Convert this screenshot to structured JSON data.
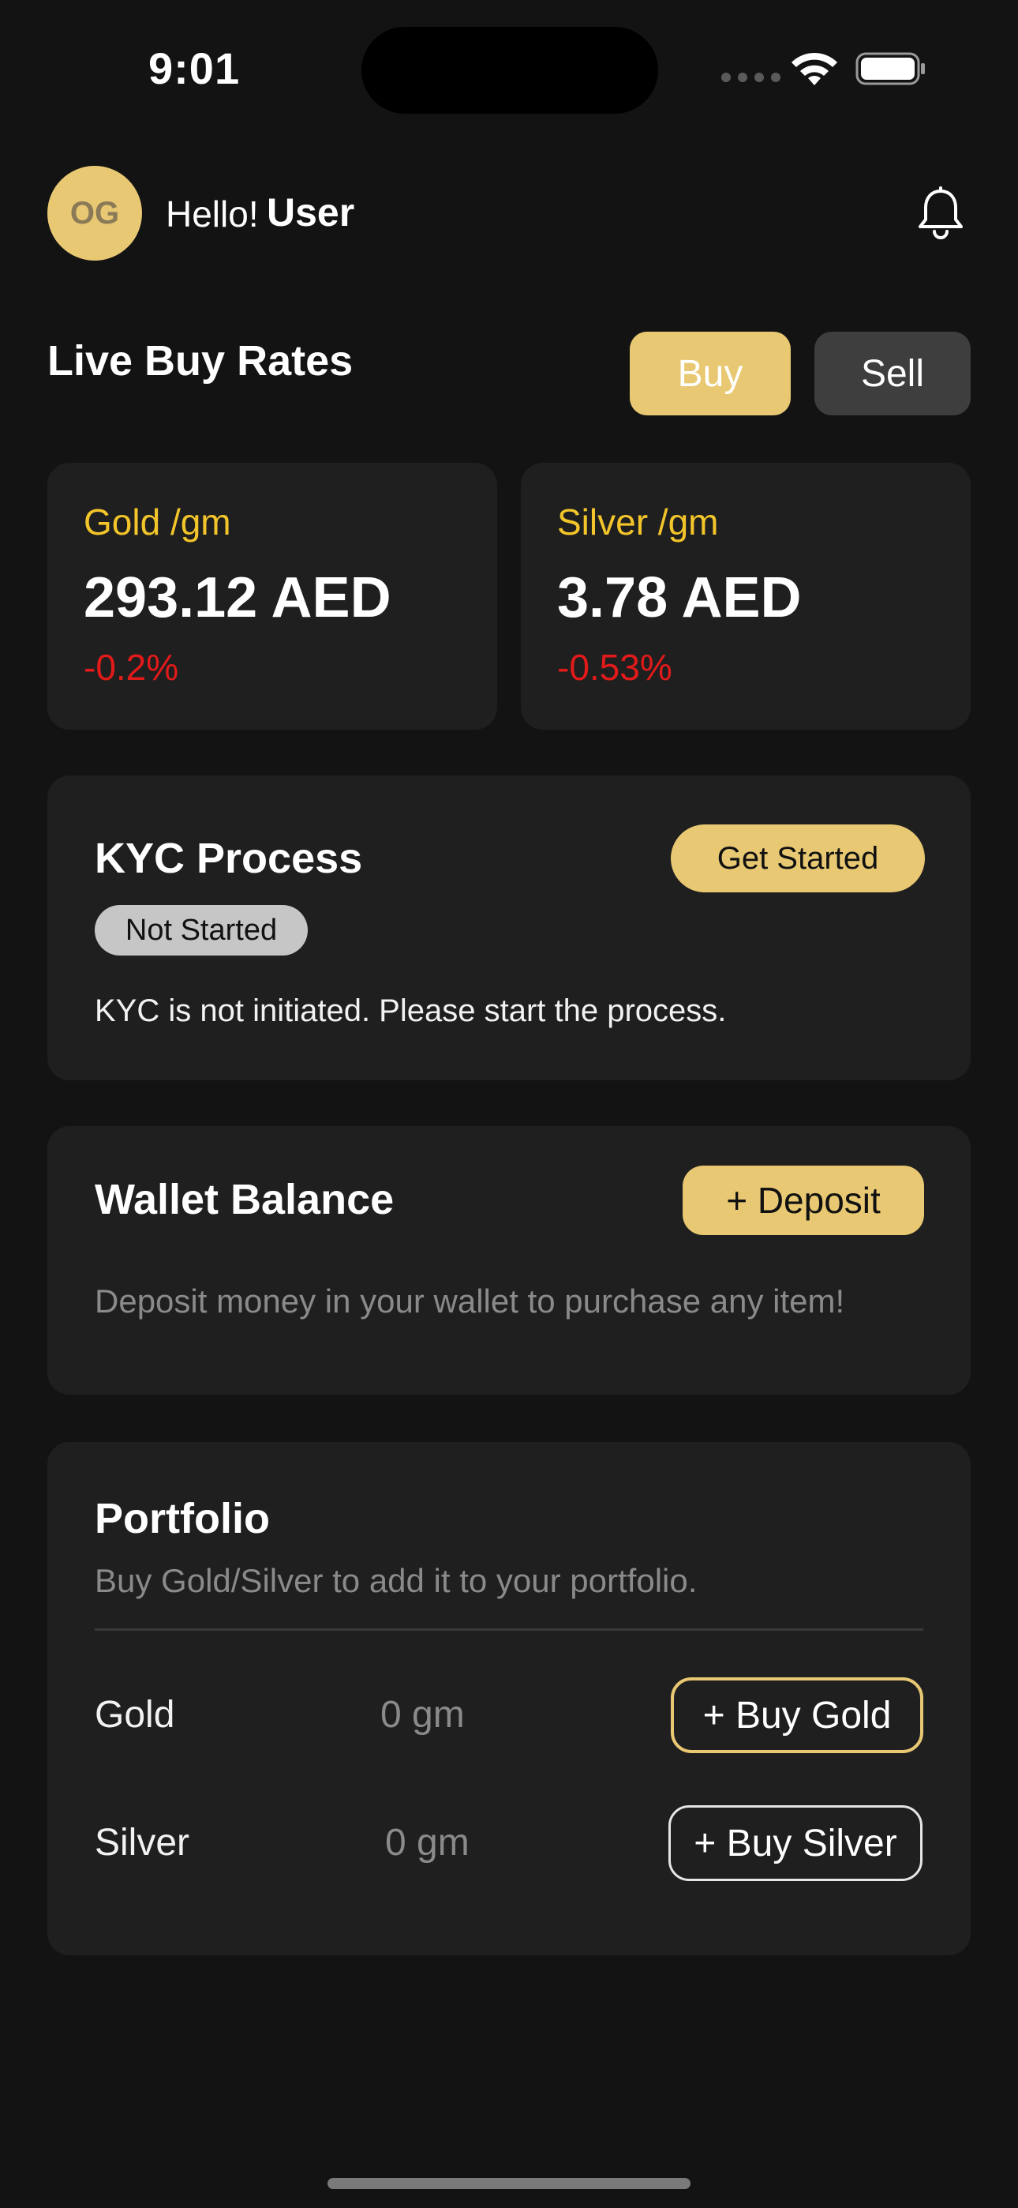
{
  "status_bar": {
    "time": "9:01"
  },
  "header": {
    "avatar_initials": "OG",
    "greeting": "Hello!",
    "username": "User",
    "notification_icon": "bell-icon"
  },
  "rates": {
    "title": "Live Buy Rates",
    "toggle": {
      "buy_label": "Buy",
      "sell_label": "Sell",
      "selected": "Buy"
    },
    "cards": [
      {
        "label": "Gold /gm",
        "value": "293.12 AED",
        "change": "-0.2%"
      },
      {
        "label": "Silver /gm",
        "value": "3.78 AED",
        "change": "-0.53%"
      }
    ]
  },
  "kyc": {
    "title": "KYC Process",
    "button_label": "Get Started",
    "status": "Not Started",
    "message": "KYC is not initiated. Please start the process."
  },
  "wallet": {
    "title": "Wallet Balance",
    "deposit_label": "+ Deposit",
    "message": "Deposit money in your wallet to purchase any item!"
  },
  "portfolio": {
    "title": "Portfolio",
    "subtitle": "Buy Gold/Silver to add it to your portfolio.",
    "rows": [
      {
        "metal": "Gold",
        "quantity": "0 gm",
        "button_label": "+ Buy Gold"
      },
      {
        "metal": "Silver",
        "quantity": "0 gm",
        "button_label": "+ Buy Silver"
      }
    ]
  },
  "colors": {
    "accent": "#e8c872",
    "label_gold": "#f3c52a",
    "negative": "#e21a1a",
    "background": "#131313",
    "card": "#1f1f1f"
  }
}
